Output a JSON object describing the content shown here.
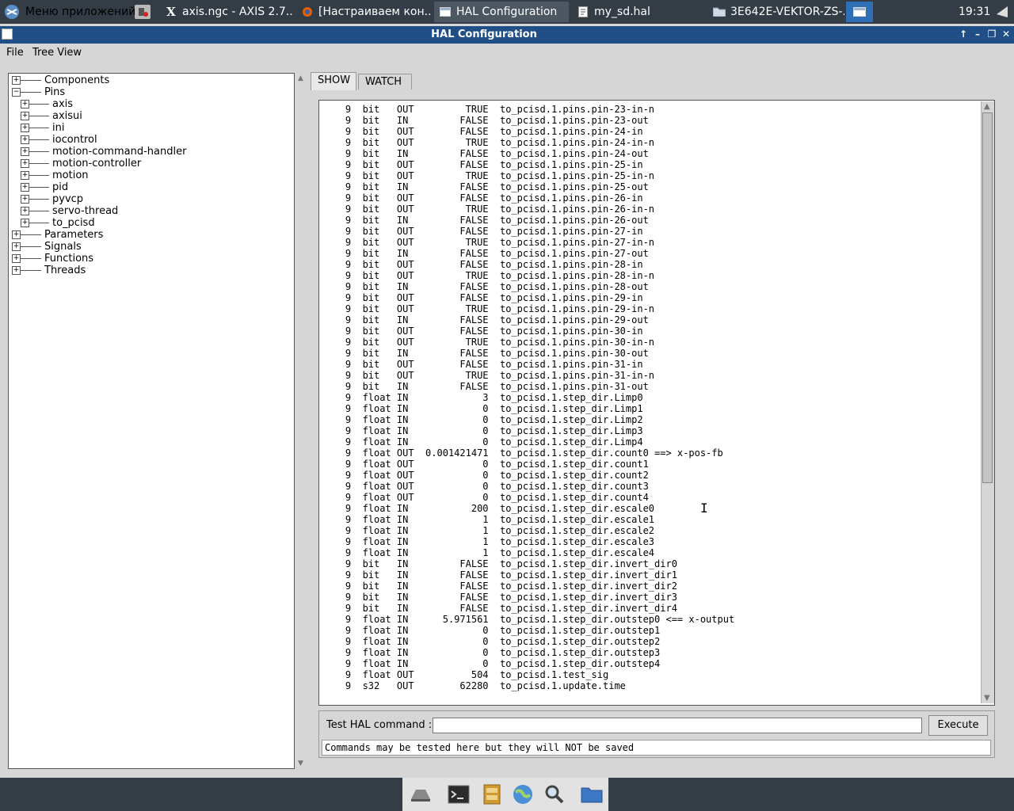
{
  "taskbar": {
    "app_menu": "Меню приложений",
    "tasks": [
      "axis.ngc - AXIS 2.7....",
      "[Настраиваем кон...",
      "HAL Configuration",
      "my_sd.hal",
      "3E642E-VEKTOR-ZS-..."
    ],
    "clock": "19:31"
  },
  "window": {
    "title": "HAL Configuration"
  },
  "menu": {
    "file": "File",
    "tree_view": "Tree View"
  },
  "tree": {
    "components": "Components",
    "pins": "Pins",
    "pin_children": [
      "axis",
      "axisui",
      "ini",
      "iocontrol",
      "motion-command-handler",
      "motion-controller",
      "motion",
      "pid",
      "pyvcp",
      "servo-thread",
      "to_pcisd"
    ],
    "parameters": "Parameters",
    "signals": "Signals",
    "functions": "Functions",
    "threads": "Threads"
  },
  "tabs": {
    "show": "SHOW",
    "watch": "WATCH"
  },
  "pins": [
    [
      "9",
      "bit",
      "OUT",
      "TRUE",
      "to_pcisd.1.pins.pin-23-in-n",
      ""
    ],
    [
      "9",
      "bit",
      "IN",
      "FALSE",
      "to_pcisd.1.pins.pin-23-out",
      ""
    ],
    [
      "9",
      "bit",
      "OUT",
      "FALSE",
      "to_pcisd.1.pins.pin-24-in",
      ""
    ],
    [
      "9",
      "bit",
      "OUT",
      "TRUE",
      "to_pcisd.1.pins.pin-24-in-n",
      ""
    ],
    [
      "9",
      "bit",
      "IN",
      "FALSE",
      "to_pcisd.1.pins.pin-24-out",
      ""
    ],
    [
      "9",
      "bit",
      "OUT",
      "FALSE",
      "to_pcisd.1.pins.pin-25-in",
      ""
    ],
    [
      "9",
      "bit",
      "OUT",
      "TRUE",
      "to_pcisd.1.pins.pin-25-in-n",
      ""
    ],
    [
      "9",
      "bit",
      "IN",
      "FALSE",
      "to_pcisd.1.pins.pin-25-out",
      ""
    ],
    [
      "9",
      "bit",
      "OUT",
      "FALSE",
      "to_pcisd.1.pins.pin-26-in",
      ""
    ],
    [
      "9",
      "bit",
      "OUT",
      "TRUE",
      "to_pcisd.1.pins.pin-26-in-n",
      ""
    ],
    [
      "9",
      "bit",
      "IN",
      "FALSE",
      "to_pcisd.1.pins.pin-26-out",
      ""
    ],
    [
      "9",
      "bit",
      "OUT",
      "FALSE",
      "to_pcisd.1.pins.pin-27-in",
      ""
    ],
    [
      "9",
      "bit",
      "OUT",
      "TRUE",
      "to_pcisd.1.pins.pin-27-in-n",
      ""
    ],
    [
      "9",
      "bit",
      "IN",
      "FALSE",
      "to_pcisd.1.pins.pin-27-out",
      ""
    ],
    [
      "9",
      "bit",
      "OUT",
      "FALSE",
      "to_pcisd.1.pins.pin-28-in",
      ""
    ],
    [
      "9",
      "bit",
      "OUT",
      "TRUE",
      "to_pcisd.1.pins.pin-28-in-n",
      ""
    ],
    [
      "9",
      "bit",
      "IN",
      "FALSE",
      "to_pcisd.1.pins.pin-28-out",
      ""
    ],
    [
      "9",
      "bit",
      "OUT",
      "FALSE",
      "to_pcisd.1.pins.pin-29-in",
      ""
    ],
    [
      "9",
      "bit",
      "OUT",
      "TRUE",
      "to_pcisd.1.pins.pin-29-in-n",
      ""
    ],
    [
      "9",
      "bit",
      "IN",
      "FALSE",
      "to_pcisd.1.pins.pin-29-out",
      ""
    ],
    [
      "9",
      "bit",
      "OUT",
      "FALSE",
      "to_pcisd.1.pins.pin-30-in",
      ""
    ],
    [
      "9",
      "bit",
      "OUT",
      "TRUE",
      "to_pcisd.1.pins.pin-30-in-n",
      ""
    ],
    [
      "9",
      "bit",
      "IN",
      "FALSE",
      "to_pcisd.1.pins.pin-30-out",
      ""
    ],
    [
      "9",
      "bit",
      "OUT",
      "FALSE",
      "to_pcisd.1.pins.pin-31-in",
      ""
    ],
    [
      "9",
      "bit",
      "OUT",
      "TRUE",
      "to_pcisd.1.pins.pin-31-in-n",
      ""
    ],
    [
      "9",
      "bit",
      "IN",
      "FALSE",
      "to_pcisd.1.pins.pin-31-out",
      ""
    ],
    [
      "9",
      "float",
      "IN",
      "3",
      "to_pcisd.1.step_dir.Limp0",
      ""
    ],
    [
      "9",
      "float",
      "IN",
      "0",
      "to_pcisd.1.step_dir.Limp1",
      ""
    ],
    [
      "9",
      "float",
      "IN",
      "0",
      "to_pcisd.1.step_dir.Limp2",
      ""
    ],
    [
      "9",
      "float",
      "IN",
      "0",
      "to_pcisd.1.step_dir.Limp3",
      ""
    ],
    [
      "9",
      "float",
      "IN",
      "0",
      "to_pcisd.1.step_dir.Limp4",
      ""
    ],
    [
      "9",
      "float",
      "OUT",
      "0.001421471",
      "to_pcisd.1.step_dir.count0",
      "==> x-pos-fb"
    ],
    [
      "9",
      "float",
      "OUT",
      "0",
      "to_pcisd.1.step_dir.count1",
      ""
    ],
    [
      "9",
      "float",
      "OUT",
      "0",
      "to_pcisd.1.step_dir.count2",
      ""
    ],
    [
      "9",
      "float",
      "OUT",
      "0",
      "to_pcisd.1.step_dir.count3",
      ""
    ],
    [
      "9",
      "float",
      "OUT",
      "0",
      "to_pcisd.1.step_dir.count4",
      ""
    ],
    [
      "9",
      "float",
      "IN",
      "200",
      "to_pcisd.1.step_dir.escale0",
      ""
    ],
    [
      "9",
      "float",
      "IN",
      "1",
      "to_pcisd.1.step_dir.escale1",
      ""
    ],
    [
      "9",
      "float",
      "IN",
      "1",
      "to_pcisd.1.step_dir.escale2",
      ""
    ],
    [
      "9",
      "float",
      "IN",
      "1",
      "to_pcisd.1.step_dir.escale3",
      ""
    ],
    [
      "9",
      "float",
      "IN",
      "1",
      "to_pcisd.1.step_dir.escale4",
      ""
    ],
    [
      "9",
      "bit",
      "IN",
      "FALSE",
      "to_pcisd.1.step_dir.invert_dir0",
      ""
    ],
    [
      "9",
      "bit",
      "IN",
      "FALSE",
      "to_pcisd.1.step_dir.invert_dir1",
      ""
    ],
    [
      "9",
      "bit",
      "IN",
      "FALSE",
      "to_pcisd.1.step_dir.invert_dir2",
      ""
    ],
    [
      "9",
      "bit",
      "IN",
      "FALSE",
      "to_pcisd.1.step_dir.invert_dir3",
      ""
    ],
    [
      "9",
      "bit",
      "IN",
      "FALSE",
      "to_pcisd.1.step_dir.invert_dir4",
      ""
    ],
    [
      "9",
      "float",
      "IN",
      "5.971561",
      "to_pcisd.1.step_dir.outstep0",
      "<== x-output"
    ],
    [
      "9",
      "float",
      "IN",
      "0",
      "to_pcisd.1.step_dir.outstep1",
      ""
    ],
    [
      "9",
      "float",
      "IN",
      "0",
      "to_pcisd.1.step_dir.outstep2",
      ""
    ],
    [
      "9",
      "float",
      "IN",
      "0",
      "to_pcisd.1.step_dir.outstep3",
      ""
    ],
    [
      "9",
      "float",
      "IN",
      "0",
      "to_pcisd.1.step_dir.outstep4",
      ""
    ],
    [
      "9",
      "float",
      "OUT",
      "504",
      "to_pcisd.1.test_sig",
      ""
    ],
    [
      "9",
      "s32",
      "OUT",
      "62280",
      "to_pcisd.1.update.time",
      ""
    ]
  ],
  "command": {
    "label": "Test HAL command :",
    "value": "",
    "execute": "Execute",
    "status": "Commands may be tested here but they will NOT be saved"
  }
}
